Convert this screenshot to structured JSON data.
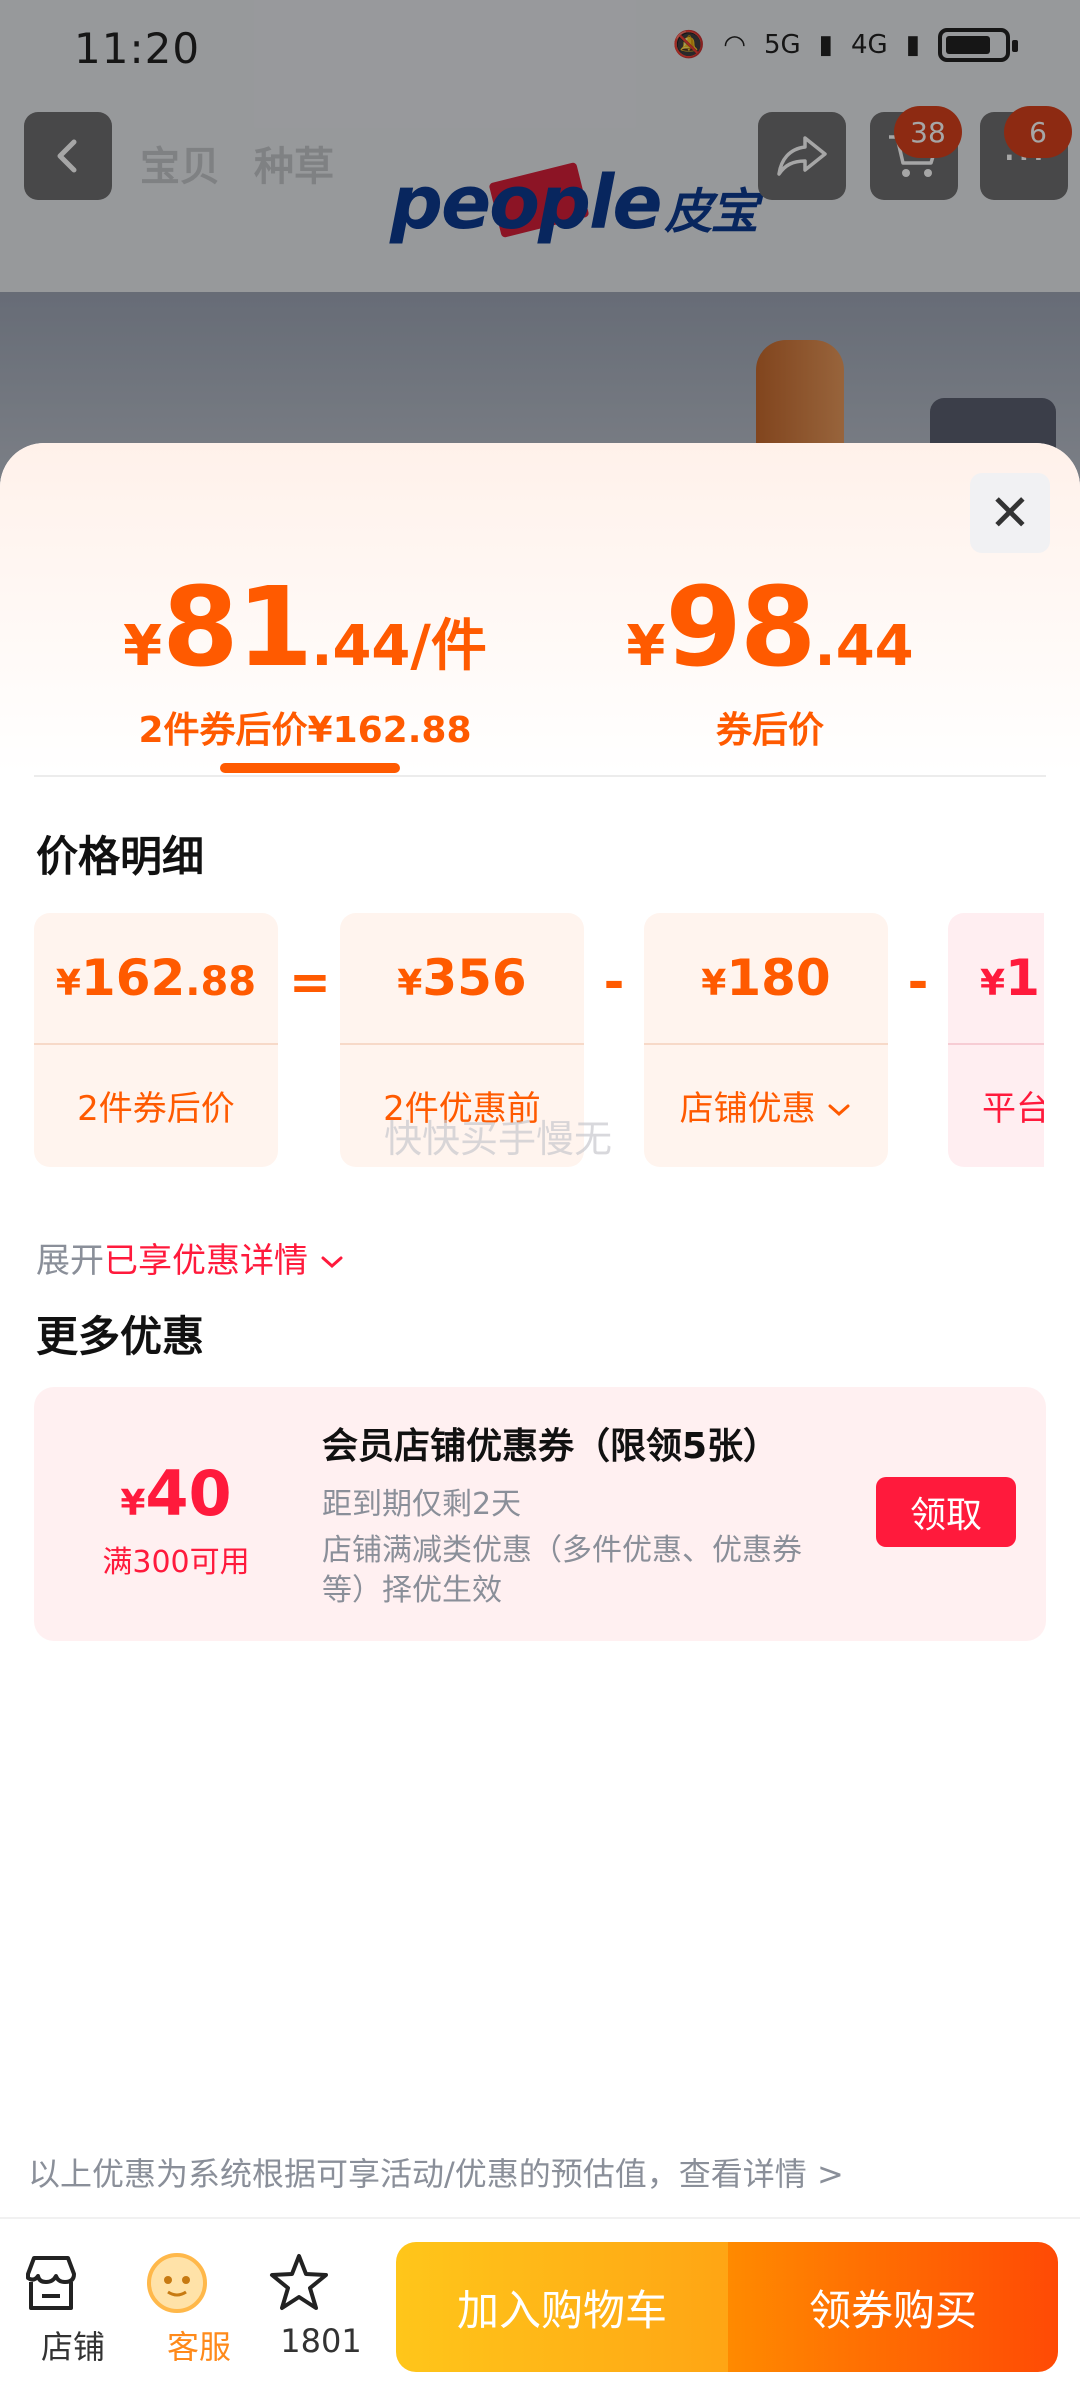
{
  "status_bar": {
    "time": "11:20",
    "signal_labels": [
      "5G",
      "4G"
    ]
  },
  "nav": {
    "tabs": [
      "宝贝",
      "种草"
    ],
    "brand": "people",
    "brand_cn": "皮宝",
    "cart_badge": "38",
    "more_badge": "6"
  },
  "price_header": {
    "left": {
      "yen": "¥",
      "int": "81",
      "dec": ".44/件",
      "sub": "2件券后价¥162.88"
    },
    "right": {
      "yen": "¥",
      "int": "98",
      "dec": ".44",
      "sub": "券后价"
    }
  },
  "detail": {
    "title": "价格明细",
    "cards": [
      {
        "yen": "¥",
        "int": "162",
        "dec": ".88",
        "label": "2件券后价"
      },
      {
        "yen": "¥",
        "int": "356",
        "dec": "",
        "label": "2件优惠前"
      },
      {
        "yen": "¥",
        "int": "180",
        "dec": "",
        "label": "店铺优惠"
      },
      {
        "yen": "¥",
        "int": "1",
        "dec": "",
        "label": "平台"
      }
    ],
    "operators": [
      "=",
      "-",
      "-"
    ]
  },
  "watermark": "快快买手慢无",
  "expand": {
    "prefix": "展开",
    "highlight": "已享优惠详情"
  },
  "more": {
    "title": "更多优惠",
    "coupon": {
      "yen": "¥",
      "amount": "40",
      "condition": "满300可用",
      "title": "会员店铺优惠券（限领5张）",
      "expire": "距到期仅剩2天",
      "desc": "店铺满减类优惠（多件优惠、优惠券等）择优生效",
      "claim_label": "领取"
    }
  },
  "disclaimer": "以上优惠为系统根据可享活动/优惠的预估值，查看详情 >",
  "bottom_bar": {
    "shop_label": "店铺",
    "service_label": "客服",
    "fav_count": "1801",
    "add_cart_label": "加入购物车",
    "buy_label": "领券购买"
  },
  "colors": {
    "accent": "#ff5a00",
    "red": "#ff1a3c",
    "grey_text": "#8a8f99"
  }
}
